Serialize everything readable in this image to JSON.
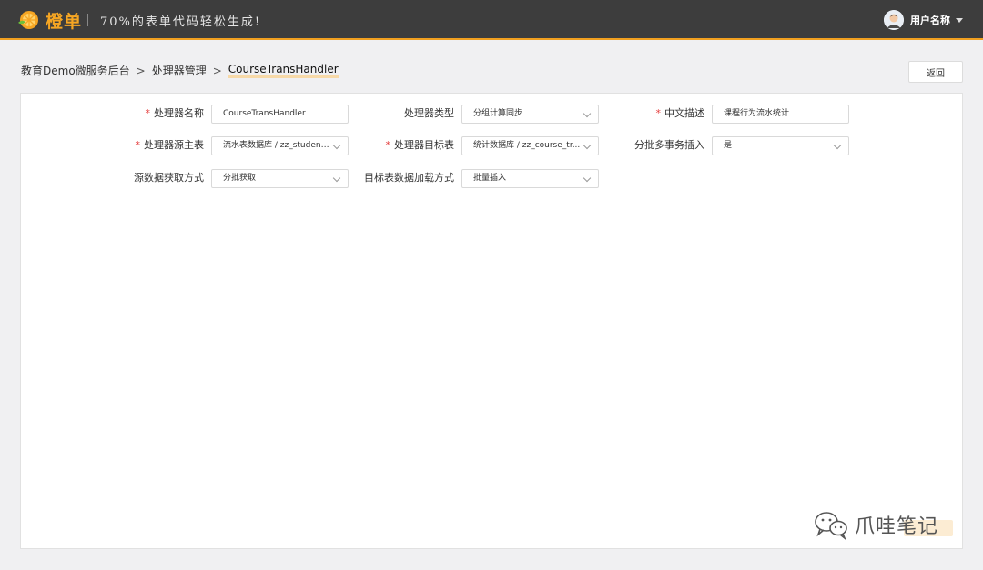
{
  "header": {
    "brand": "橙单",
    "slogan": "70%的表单代码轻松生成!",
    "user_name": "用户名称"
  },
  "breadcrumb": {
    "items": [
      "教育Demo微服务后台",
      "处理器管理"
    ],
    "current": "CourseTransHandler",
    "separator": ">"
  },
  "back_label": "返回",
  "form": {
    "handler_name": {
      "label": "处理器名称",
      "required": "*",
      "value": "CourseTransHandler"
    },
    "handler_type": {
      "label": "处理器类型",
      "value": "分组计算同步"
    },
    "cn_desc": {
      "label": "中文描述",
      "required": "*",
      "value": "课程行为流水统计"
    },
    "source_table": {
      "label": "处理器源主表",
      "required": "*",
      "value": "流水表数据库 / zz_student_..."
    },
    "target_table": {
      "label": "处理器目标表",
      "required": "*",
      "value": "统计数据库 / zz_course_tr..."
    },
    "batch_insert": {
      "label": "分批多事务插入",
      "value": "是"
    },
    "source_fetch": {
      "label": "源数据获取方式",
      "value": "分批获取"
    },
    "target_load": {
      "label": "目标表数据加载方式",
      "value": "批量插入"
    }
  },
  "watermark": {
    "text": "爪哇笔记"
  },
  "colors": {
    "header_bg": "#3d3d3d",
    "accent": "#f6a623",
    "required": "#e53d3d"
  },
  "icons": [
    "orange-logo-icon",
    "user-avatar-icon",
    "caret-down-icon",
    "chevron-down-icon",
    "wechat-icon"
  ]
}
